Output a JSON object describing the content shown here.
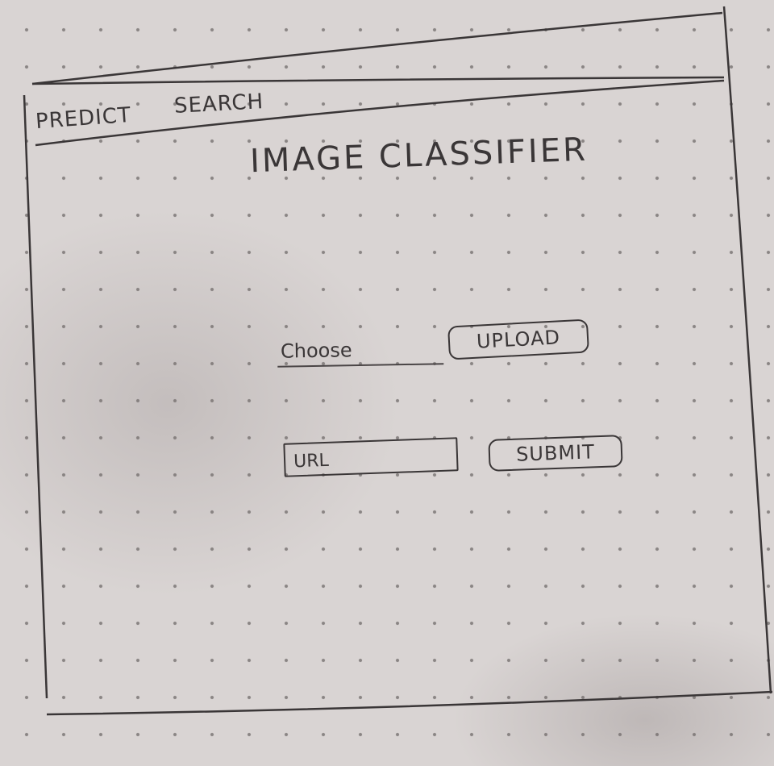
{
  "nav": {
    "items": [
      {
        "label": "PREDICT"
      },
      {
        "label": "SEARCH"
      }
    ]
  },
  "main": {
    "title": "IMAGE CLASSIFIER",
    "choose_label": "Choose",
    "upload_label": "UPLOAD",
    "url_placeholder": "URL",
    "submit_label": "SUBMIT"
  }
}
